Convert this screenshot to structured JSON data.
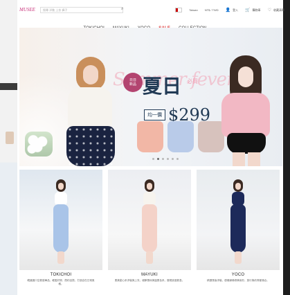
{
  "header": {
    "logo_text": "MUSEE",
    "search_placeholder": "搜尋  洋裝  上衣  褲子",
    "right": {
      "language_label": "Taiwan",
      "currency_label": "NT$ / TWD",
      "login_label": "登入",
      "cart_label": "購物車",
      "wishlist_label": "收藏清單"
    }
  },
  "nav": {
    "items": [
      "TOKICHOI",
      "MAYUKI",
      "YOCO",
      "SALE",
      "COLLECTION"
    ]
  },
  "hero": {
    "script_title": "Summer fever",
    "badge_line1": "日日",
    "badge_line2": "新品",
    "main_title": "夏日",
    "pink_small": "必買",
    "chip_label": "均一價",
    "price_text": "$299",
    "slides_active": 1,
    "slides_total": 6
  },
  "cards": [
    {
      "brand": "TOKICHOI",
      "desc": "韓國進口空氣感單品，輕盈好穿，簡約百搭，打造自在日常風格。"
    },
    {
      "brand": "MAYUKI",
      "desc": "柔美甜心系洋裝與上衣，細節蕾絲與溫柔色系，展現浪漫氣息。"
    },
    {
      "brand": "YOCO",
      "desc": "精選長版洋裝，優雅線條修飾身形，旅行與約會都適合。"
    }
  ],
  "colors": {
    "accent_pink": "#c8327b",
    "sale_red": "#dd3333",
    "navy": "#213a55"
  }
}
